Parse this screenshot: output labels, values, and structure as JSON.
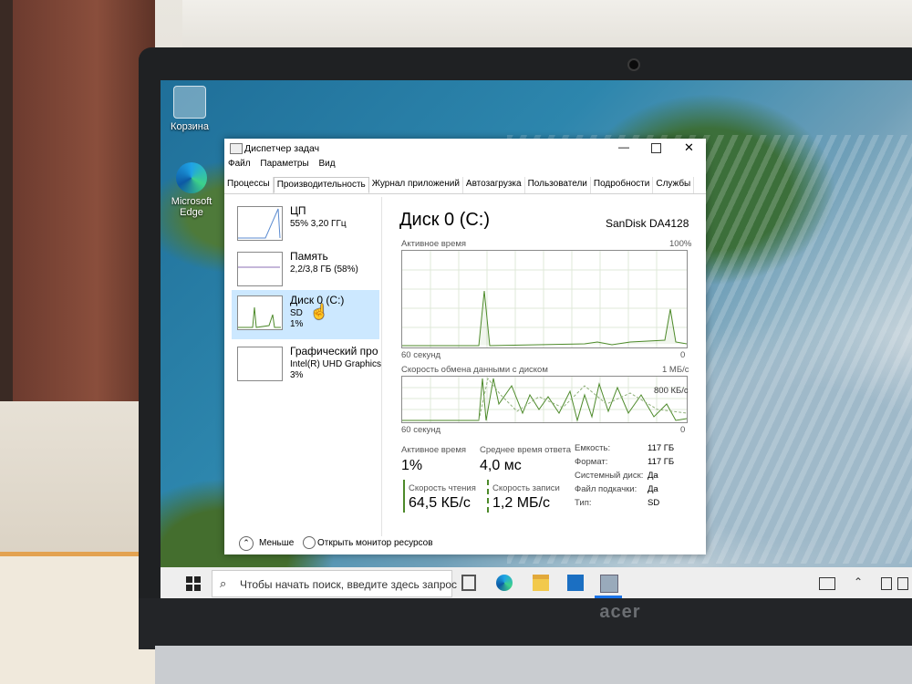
{
  "desktop": {
    "icons": [
      {
        "label": "Корзина",
        "icon": "recycle-bin-icon"
      },
      {
        "label": "Microsoft Edge",
        "icon": "edge-icon"
      }
    ]
  },
  "window": {
    "title": "Диспетчер задач",
    "menu": [
      "Файл",
      "Параметры",
      "Вид"
    ],
    "tabs": [
      "Процессы",
      "Производительность",
      "Журнал приложений",
      "Автозагрузка",
      "Пользователи",
      "Подробности",
      "Службы"
    ],
    "active_tab": "Производительность"
  },
  "sidebar": {
    "items": [
      {
        "name": "ЦП",
        "line1": "55%  3,20 ГГц",
        "line2": ""
      },
      {
        "name": "Память",
        "line1": "2,2/3,8 ГБ (58%)",
        "line2": ""
      },
      {
        "name": "Диск 0 (C:)",
        "line1": "SD",
        "line2": "1%"
      },
      {
        "name": "Графический про",
        "line1": "Intel(R) UHD Graphics",
        "line2": "3%"
      }
    ]
  },
  "detail": {
    "heading": "Диск 0 (C:)",
    "model": "SanDisk DA4128",
    "graph1": {
      "label": "Активное время",
      "max": "100%",
      "time": "60 секунд",
      "min": "0"
    },
    "graph2": {
      "label": "Скорость обмена данными с диском",
      "max": "1 МБ/с",
      "mid": "800 КБ/с",
      "time": "60 секунд",
      "min": "0"
    },
    "stats": {
      "active_time_label": "Активное время",
      "active_time_value": "1%",
      "avg_response_label": "Среднее время ответа",
      "avg_response_value": "4,0 мс",
      "read_speed_label": "Скорость чтения",
      "read_speed_value": "64,5 КБ/с",
      "write_speed_label": "Скорость записи",
      "write_speed_value": "1,2 МБ/с"
    },
    "props": [
      {
        "k": "Емкость:",
        "v": "117 ГБ"
      },
      {
        "k": "Формат:",
        "v": "117 ГБ"
      },
      {
        "k": "Системный диск:",
        "v": "Да"
      },
      {
        "k": "Файл подкачки:",
        "v": "Да"
      },
      {
        "k": "Тип:",
        "v": "SD"
      }
    ]
  },
  "footer": {
    "less": "Меньше",
    "monitor": "Открыть монитор ресурсов"
  },
  "taskbar": {
    "search_placeholder": "Чтобы начать поиск, введите здесь запрос"
  },
  "brand": "acer",
  "colors": {
    "selection": "#cce8ff",
    "disk_graph_line": "#4d8a2a"
  }
}
